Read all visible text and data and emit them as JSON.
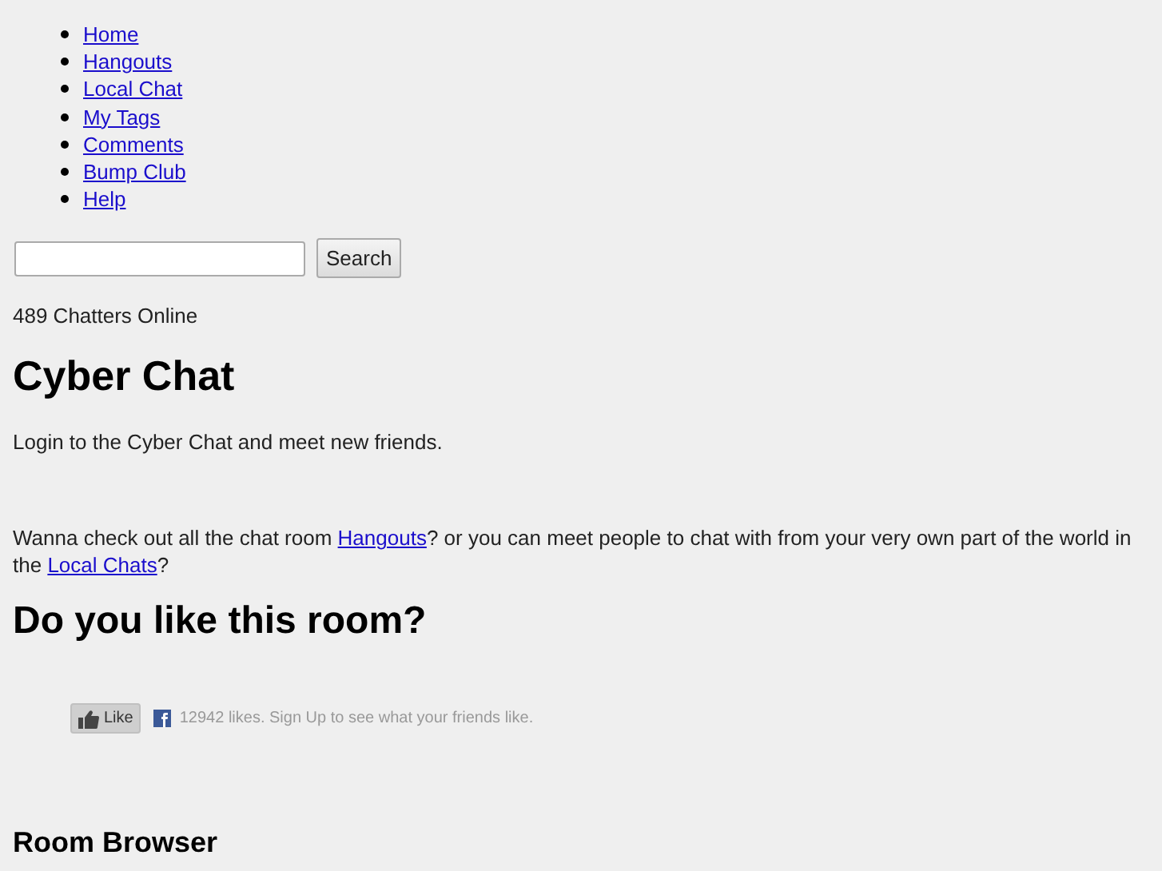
{
  "nav": [
    {
      "label": "Home"
    },
    {
      "label": "Hangouts"
    },
    {
      "label": "Local Chat"
    },
    {
      "label": "My Tags"
    },
    {
      "label": "Comments"
    },
    {
      "label": "Bump Club"
    },
    {
      "label": "Help"
    }
  ],
  "search": {
    "button": "Search"
  },
  "online": "489 Chatters Online",
  "title": "Cyber Chat",
  "intro": "Login to the Cyber Chat and meet new friends.",
  "links_paragraph": {
    "before": "Wanna check out all the chat room ",
    "link1": "Hangouts",
    "middle": "? or you can meet people to chat with from your very own part of the world in the ",
    "link2": "Local Chats",
    "after": "?"
  },
  "like_heading": "Do you like this room?",
  "like_widget": {
    "button": "Like",
    "count": "12942 likes.",
    "signup": "Sign Up",
    "after": "to see what your friends like."
  },
  "browser_heading": "Room Browser"
}
